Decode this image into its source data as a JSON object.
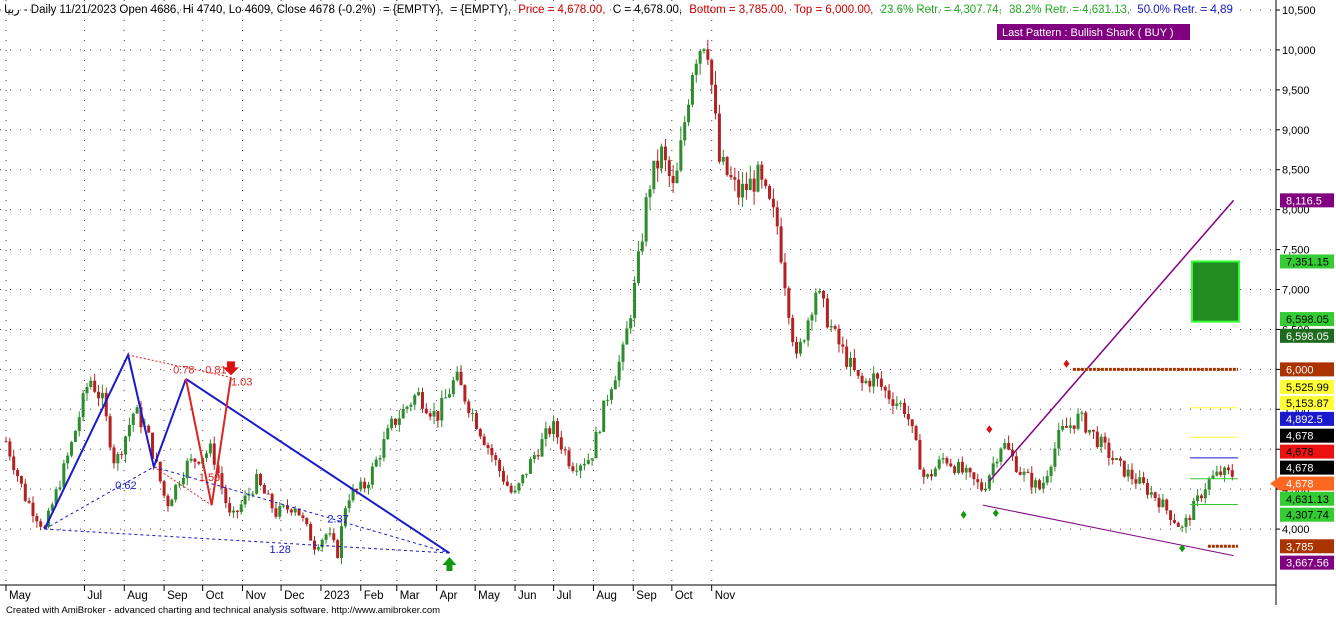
{
  "header": {
    "symbol": "ربيا",
    "text": "- Daily 11/21/2023 Open 4686, Hi 4740, Lo 4609, Close 4678 (-0.2%)",
    "empty1": "= {EMPTY},",
    "empty2": "= {EMPTY},",
    "price": "Price = 4,678.00,",
    "c": "C = 4,678.00,",
    "bottom": "Bottom = 3,785.00,",
    "top": "Top = 6,000.00,",
    "r236": "23.6% Retr. = 4,307.74,",
    "r382": "38.2% Retr. = 4,631.13,",
    "r50": "50.0% Retr. = 4,89"
  },
  "pattern_label": "Last Pattern : Bullish Shark ( BUY )",
  "footer": "Created with AmiBroker - advanced charting and technical analysis software. http://www.amibroker.com",
  "colors": {
    "up": "#2e8b2e",
    "down": "#b22222",
    "harmonic_blue": "#1a1acc",
    "harmonic_red": "#dd2222",
    "channel": "#800080",
    "target_box": "#228b22",
    "level": "#aa3300"
  },
  "chart_data": {
    "type": "candlestick",
    "title": "",
    "ylim": [
      3300,
      10500
    ],
    "y_ticks": [
      4000,
      4500,
      5000,
      5500,
      6000,
      6500,
      7000,
      7500,
      8000,
      8500,
      9000,
      9500,
      10000,
      10500
    ],
    "y_tick_labels": [
      "4,000",
      "4,500",
      "5,000",
      "5,500",
      "6,000",
      "6,500",
      "7,000",
      "7,500",
      "8,000",
      "8,500",
      "9,000",
      "9,500",
      "10,000",
      "10,500"
    ],
    "x_labels": [
      "May",
      "Jul",
      "Aug",
      "Sep",
      "Oct",
      "Nov",
      "Dec",
      "2023",
      "Feb",
      "Mar",
      "Apr",
      "May",
      "Jun",
      "Jul",
      "Aug",
      "Sep",
      "Oct",
      "Nov"
    ],
    "x_label_days": [
      0,
      61,
      92,
      123,
      153,
      184,
      214,
      245,
      276,
      304,
      335,
      365,
      396,
      426,
      457,
      488,
      518,
      549
    ],
    "price_path": [
      [
        0,
        5100
      ],
      [
        15,
        4400
      ],
      [
        30,
        4000
      ],
      [
        50,
        5000
      ],
      [
        65,
        5900
      ],
      [
        75,
        5600
      ],
      [
        85,
        4800
      ],
      [
        100,
        5500
      ],
      [
        110,
        5200
      ],
      [
        125,
        4300
      ],
      [
        140,
        4800
      ],
      [
        160,
        5000
      ],
      [
        175,
        4100
      ],
      [
        195,
        4600
      ],
      [
        210,
        4200
      ],
      [
        225,
        4300
      ],
      [
        240,
        3800
      ],
      [
        250,
        3950
      ],
      [
        258,
        3700
      ],
      [
        265,
        4400
      ],
      [
        280,
        4550
      ],
      [
        300,
        5300
      ],
      [
        320,
        5700
      ],
      [
        335,
        5400
      ],
      [
        350,
        5900
      ],
      [
        370,
        5200
      ],
      [
        385,
        4700
      ],
      [
        395,
        4400
      ],
      [
        410,
        4900
      ],
      [
        425,
        5300
      ],
      [
        440,
        4800
      ],
      [
        455,
        4900
      ],
      [
        470,
        5800
      ],
      [
        480,
        6200
      ],
      [
        490,
        7100
      ],
      [
        500,
        8300
      ],
      [
        510,
        8700
      ],
      [
        520,
        8200
      ],
      [
        535,
        9900
      ],
      [
        545,
        10200
      ],
      [
        555,
        8600
      ],
      [
        570,
        8200
      ],
      [
        585,
        8400
      ],
      [
        600,
        7800
      ],
      [
        615,
        6100
      ],
      [
        630,
        7000
      ],
      [
        645,
        6400
      ],
      [
        655,
        6100
      ],
      [
        665,
        5800
      ],
      [
        675,
        5900
      ],
      [
        685,
        5700
      ],
      [
        700,
        5500
      ],
      [
        715,
        4600
      ],
      [
        730,
        4900
      ],
      [
        745,
        4700
      ],
      [
        760,
        4500
      ],
      [
        775,
        5100
      ],
      [
        790,
        4700
      ],
      [
        805,
        4500
      ],
      [
        820,
        5200
      ],
      [
        835,
        5400
      ],
      [
        850,
        5100
      ],
      [
        865,
        4800
      ],
      [
        880,
        4600
      ],
      [
        895,
        4400
      ],
      [
        905,
        4200
      ],
      [
        915,
        4000
      ],
      [
        925,
        4300
      ],
      [
        935,
        4600
      ],
      [
        945,
        4700
      ],
      [
        955,
        4680
      ]
    ],
    "bottom": 3785,
    "top": 6000,
    "retr_23_6": 4307.74,
    "retr_38_2": 4631.13,
    "retr_50": 4892.5,
    "close": 4678,
    "right_labels": [
      {
        "text": "8,116.5",
        "value": 8116.5,
        "bg": "#800080",
        "fg": "#ffffff"
      },
      {
        "text": "7,351.15",
        "value": 7351.15,
        "bg": "#33cc33",
        "fg": "#000000"
      },
      {
        "text": "6,598.05",
        "value": 6630,
        "bg": "#33cc33",
        "fg": "#000000"
      },
      {
        "text": "6,598.05",
        "value": 6420,
        "bg": "#1e6b1e",
        "fg": "#ffffff"
      },
      {
        "text": "6,000",
        "value": 6000,
        "bg": "#aa3300",
        "fg": "#ffffff"
      },
      {
        "text": "5,525.99",
        "value": 5780,
        "bg": "#ffff33",
        "fg": "#000000"
      },
      {
        "text": "5,153.87",
        "value": 5580,
        "bg": "#ffff33",
        "fg": "#000000"
      },
      {
        "text": "4,892.5",
        "value": 5380,
        "bg": "#1a1acc",
        "fg": "#ffffff"
      },
      {
        "text": "4,678",
        "value": 5170,
        "bg": "#000000",
        "fg": "#ffffff"
      },
      {
        "text": "4,678",
        "value": 4970,
        "bg": "#ee1111",
        "fg": "#000000"
      },
      {
        "text": "4,678",
        "value": 4770,
        "bg": "#000000",
        "fg": "#ffffff"
      },
      {
        "text": "4,678",
        "value": 4570,
        "bg": "#ff6622",
        "fg": "#ffffff"
      },
      {
        "text": "4,631.13",
        "value": 4380,
        "bg": "#33cc33",
        "fg": "#000000"
      },
      {
        "text": "4,307.74",
        "value": 4180,
        "bg": "#33cc33",
        "fg": "#000000"
      },
      {
        "text": "3,785",
        "value": 3785,
        "bg": "#aa3300",
        "fg": "#ffffff"
      },
      {
        "text": "3,667.56",
        "value": 3580,
        "bg": "#800080",
        "fg": "#ffffff"
      }
    ],
    "harmonic_labels": [
      {
        "text": "0.62",
        "day": 85,
        "value": 4500,
        "color": "#1a1acc"
      },
      {
        "text": "0.78",
        "day": 130,
        "value": 5950,
        "color": "#dd2222"
      },
      {
        "text": "0.81",
        "day": 155,
        "value": 5950,
        "color": "#dd2222"
      },
      {
        "text": "1.03",
        "day": 175,
        "value": 5800,
        "color": "#dd2222"
      },
      {
        "text": "1.50",
        "day": 150,
        "value": 4600,
        "color": "#dd2222"
      },
      {
        "text": "2.37",
        "day": 250,
        "value": 4080,
        "color": "#1a1acc"
      },
      {
        "text": "1.28",
        "day": 205,
        "value": 3700,
        "color": "#1a1acc"
      }
    ]
  }
}
